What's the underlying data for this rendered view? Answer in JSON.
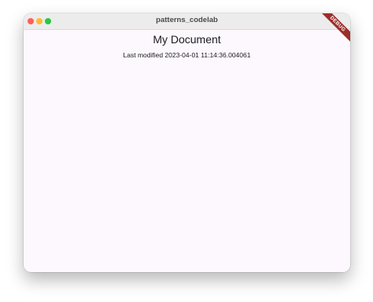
{
  "window": {
    "title": "patterns_codelab"
  },
  "document": {
    "title": "My Document",
    "last_modified": "Last modified 2023-04-01 11:14:36.004061"
  },
  "debug_banner": {
    "label": "DEBUG"
  }
}
